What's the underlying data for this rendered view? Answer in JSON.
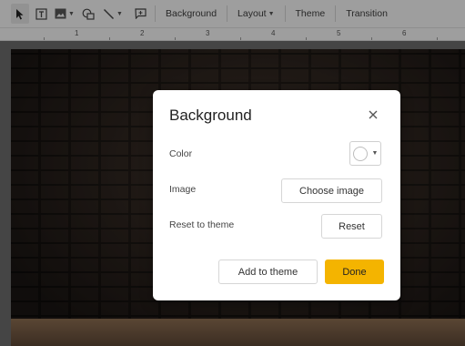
{
  "toolbar": {
    "tools": [
      {
        "name": "select-tool",
        "icon": "cursor-icon"
      },
      {
        "name": "text-box-tool",
        "icon": "text-box-icon"
      },
      {
        "name": "image-tool",
        "icon": "image-icon"
      },
      {
        "name": "shape-tool",
        "icon": "shape-icon"
      },
      {
        "name": "line-tool",
        "icon": "line-icon"
      },
      {
        "name": "comment-tool",
        "icon": "comment-icon"
      }
    ],
    "background_label": "Background",
    "layout_label": "Layout",
    "theme_label": "Theme",
    "transition_label": "Transition"
  },
  "ruler": {
    "numbers": [
      "1",
      "2",
      "3",
      "4",
      "5",
      "6"
    ]
  },
  "dialog": {
    "title": "Background",
    "color_label": "Color",
    "color_value": "#ffffff",
    "image_label": "Image",
    "choose_image_label": "Choose image",
    "reset_label": "Reset to theme",
    "reset_button_label": "Reset",
    "add_to_theme_label": "Add to theme",
    "done_label": "Done"
  },
  "colors": {
    "accent": "#f4b400",
    "toolbar_bg": "#f3f3f3",
    "dialog_bg": "#ffffff"
  }
}
